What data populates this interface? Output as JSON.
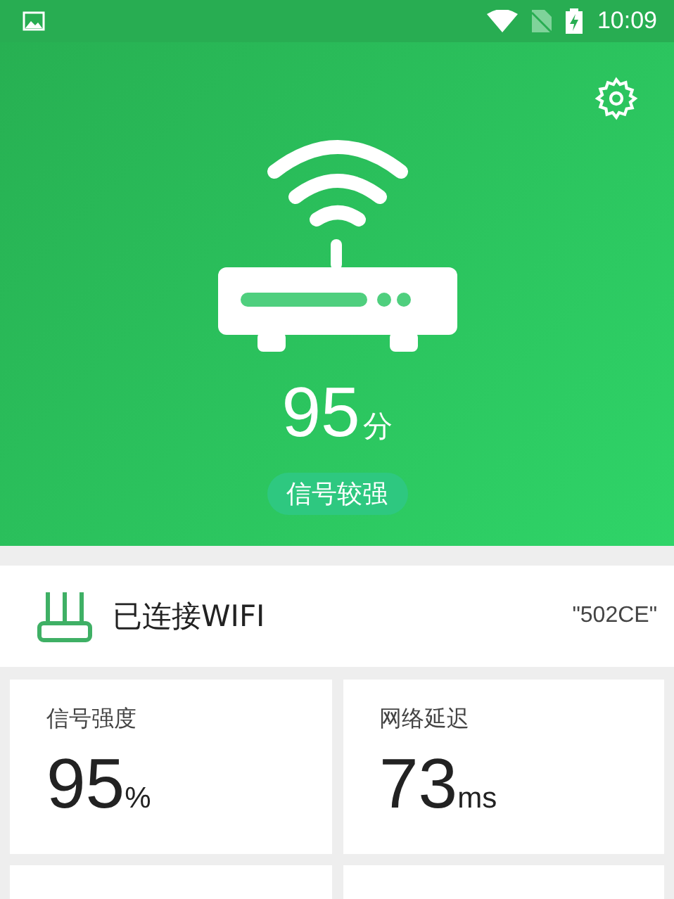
{
  "status_bar": {
    "time": "10:09"
  },
  "header": {
    "score": "95",
    "score_unit": "分",
    "signal_label": "信号较强"
  },
  "connection": {
    "label": "已连接WIFI",
    "ssid": "\"502CE\""
  },
  "stats": [
    {
      "label": "信号强度",
      "value": "95",
      "unit": "%"
    },
    {
      "label": "网络延迟",
      "value": "73",
      "unit": "ms"
    }
  ],
  "more_cards": [
    {
      "kind": "blank"
    },
    {
      "kind": "blank"
    }
  ]
}
